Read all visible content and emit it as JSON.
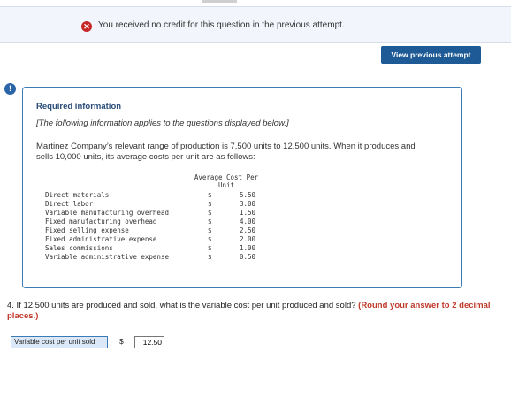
{
  "banner": {
    "message": "You received no credit for this question in the previous attempt."
  },
  "view_previous_button": "View previous attempt",
  "info": {
    "title": "Required information",
    "subtitle": "[The following information applies to the questions displayed below.]",
    "body": "Martinez Company’s relevant range of production is 7,500 units to 12,500 units. When it produces and sells 10,000 units, its average costs per unit are as follows:",
    "column_header": "Average Cost Per Unit",
    "rows": [
      {
        "label": "Direct materials",
        "dollar": "$",
        "value": "5.50"
      },
      {
        "label": "Direct labor",
        "dollar": "$",
        "value": "3.00"
      },
      {
        "label": "Variable manufacturing overhead",
        "dollar": "$",
        "value": "1.50"
      },
      {
        "label": "Fixed manufacturing overhead",
        "dollar": "$",
        "value": "4.00"
      },
      {
        "label": "Fixed selling expense",
        "dollar": "$",
        "value": "2.50"
      },
      {
        "label": "Fixed administrative expense",
        "dollar": "$",
        "value": "2.00"
      },
      {
        "label": "Sales commissions",
        "dollar": "$",
        "value": "1.00"
      },
      {
        "label": "Variable administrative expense",
        "dollar": "$",
        "value": "0.50"
      }
    ]
  },
  "question": {
    "text": "4. If 12,500 units are produced and sold, what is the variable cost per unit produced and sold?",
    "hint": "(Round your answer to 2 decimal places.)"
  },
  "answer": {
    "label": "Variable cost per unit sold",
    "dollar": "$",
    "value": "12.50"
  },
  "colors": {
    "accent": "#1d5a96",
    "error": "#c62828",
    "hint": "#c0392b",
    "box_border": "#3a7bb5"
  }
}
